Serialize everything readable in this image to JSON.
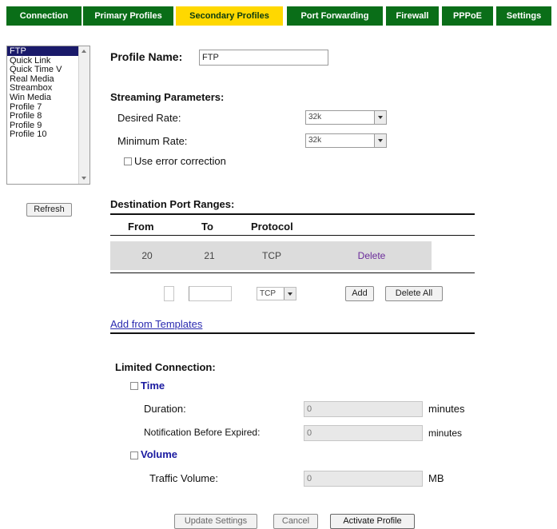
{
  "tabs": [
    {
      "label": "Connection"
    },
    {
      "label": "Primary Profiles"
    },
    {
      "label": "Secondary Profiles"
    },
    {
      "label": "Port Forwarding"
    },
    {
      "label": "Firewall"
    },
    {
      "label": "PPPoE"
    },
    {
      "label": "Settings"
    }
  ],
  "active_tab": "Secondary Profiles",
  "profiles": [
    "FTP",
    "Quick Link",
    "Quick Time V",
    "Real Media",
    "Streambox",
    "Win Media",
    "Profile 7",
    "Profile 8",
    "Profile 9",
    "Profile 10"
  ],
  "selected_profile": "FTP",
  "refresh_label": "Refresh",
  "profile_name": {
    "label": "Profile Name:",
    "value": "FTP"
  },
  "streaming": {
    "heading": "Streaming Parameters:",
    "desired_rate_label": "Desired Rate:",
    "desired_rate_value": "32k",
    "minimum_rate_label": "Minimum Rate:",
    "minimum_rate_value": "32k",
    "error_correction_label": "Use error correction"
  },
  "ports": {
    "heading": "Destination Port Ranges:",
    "columns": [
      "From",
      "To",
      "Protocol"
    ],
    "rows": [
      {
        "from": "20",
        "to": "21",
        "protocol": "TCP",
        "action": "Delete"
      }
    ],
    "new_protocol": "TCP",
    "add_label": "Add",
    "delete_all_label": "Delete All",
    "templates_link": "Add from Templates"
  },
  "limited": {
    "heading": "Limited Connection:",
    "time_label": "Time",
    "duration_label": "Duration:",
    "duration_value": "0",
    "duration_unit": "minutes",
    "notify_label": "Notification Before Expired:",
    "notify_value": "0",
    "notify_unit": "minutes",
    "volume_label": "Volume",
    "traffic_label": "Traffic Volume:",
    "traffic_value": "0",
    "traffic_unit": "MB"
  },
  "buttons": {
    "update": "Update Settings",
    "cancel": "Cancel",
    "activate": "Activate Profile"
  },
  "colors": {
    "tab_bg": "#0a6e18",
    "tab_active": "#ffd800",
    "link": "#2b2bb0"
  }
}
